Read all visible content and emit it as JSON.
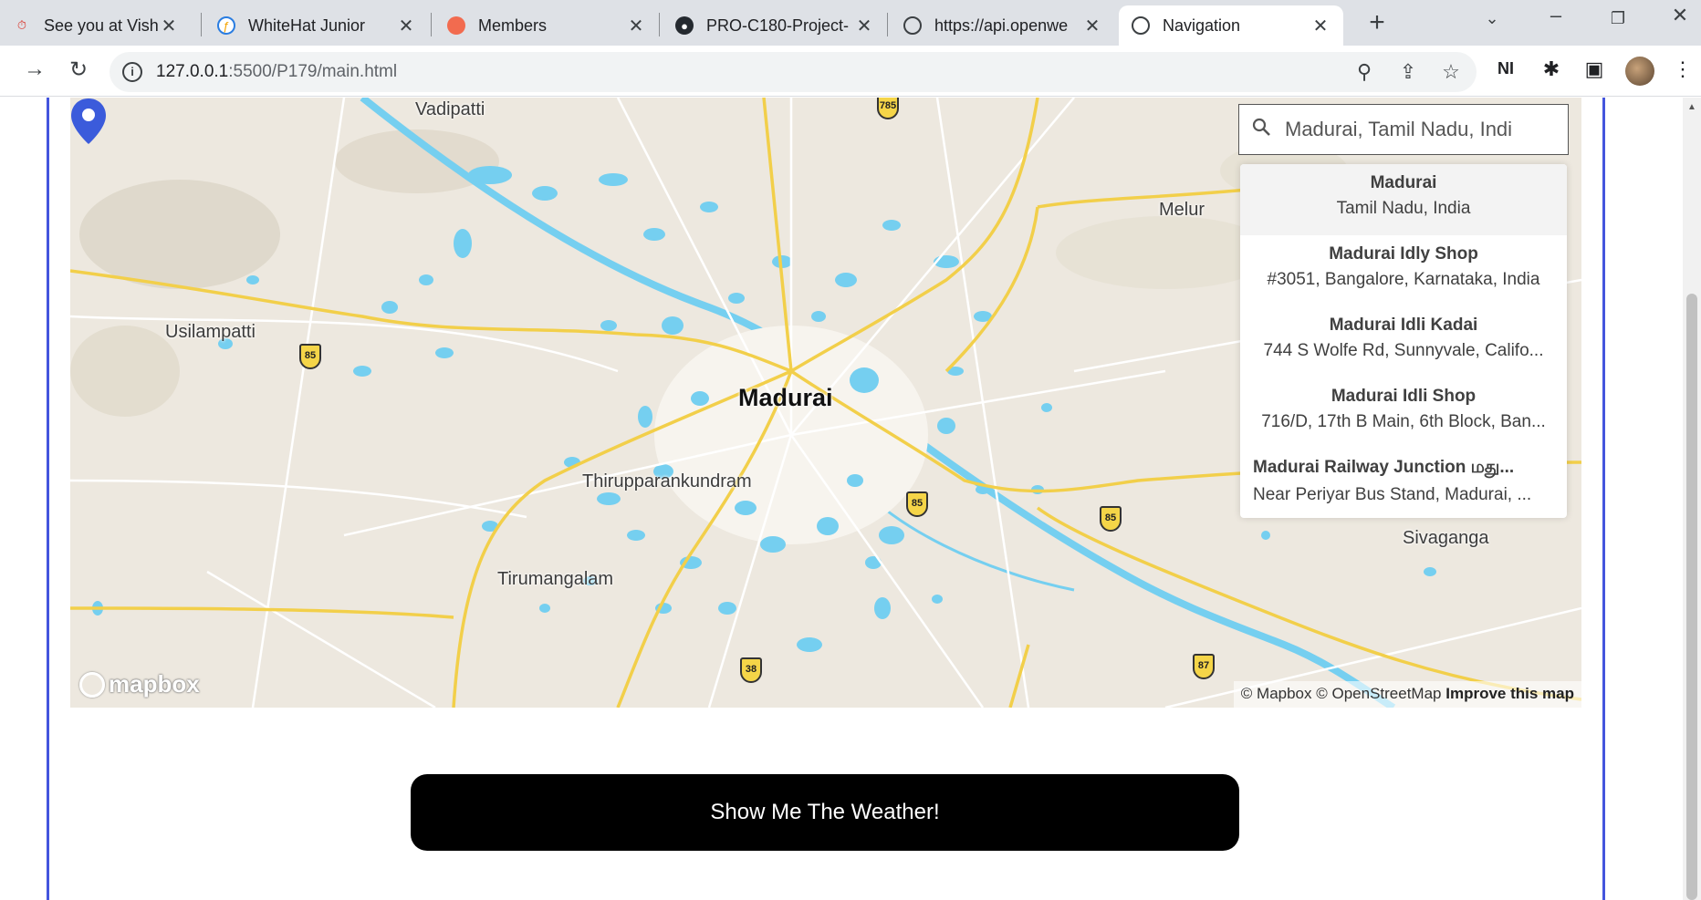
{
  "browser": {
    "tabs": [
      {
        "title": "See you at Vishn",
        "favicon": "stopwatch-icon"
      },
      {
        "title": "WhiteHat Junior",
        "favicon": "whitehat-icon"
      },
      {
        "title": "Members",
        "favicon": "members-icon"
      },
      {
        "title": "PRO-C180-Project-",
        "favicon": "github-icon"
      },
      {
        "title": "https://api.openwe",
        "favicon": "globe-icon"
      },
      {
        "title": "Navigation",
        "favicon": "globe-icon",
        "active": true
      }
    ],
    "url_host": "127.0.0.1",
    "url_path": ":5500/P179/main.html"
  },
  "map": {
    "places": {
      "vadipatti": "Vadipatti",
      "melur": "Melur",
      "usilampatti": "Usilampatti",
      "madurai": "Madurai",
      "thirupparankundram": "Thirupparankundram",
      "tirumangalam": "Tirumangalam",
      "sivaganga": "Sivaganga"
    },
    "shields": {
      "s785": "785",
      "s85a": "85",
      "s85b": "85",
      "s85c": "85",
      "s38": "38",
      "s87": "87"
    },
    "logo": "mapbox",
    "attribution": "© Mapbox © OpenStreetMap",
    "improve_link": "Improve this map",
    "colors": {
      "land": "#ede8df",
      "water": "#75cff0",
      "road": "#f2cf4a",
      "pin": "#3b5bdb"
    }
  },
  "geocoder": {
    "value": "Madurai, Tamil Nadu, Indi",
    "suggestions": [
      {
        "name": "Madurai",
        "address": "Tamil Nadu, India"
      },
      {
        "name": "Madurai Idly Shop",
        "address": "#3051, Bangalore, Karnataka, India"
      },
      {
        "name": "Madurai Idli Kadai",
        "address": "744 S Wolfe Rd, Sunnyvale, Califo..."
      },
      {
        "name": "Madurai Idli Shop",
        "address": "716/D, 17th B Main, 6th Block, Ban..."
      },
      {
        "name": "Madurai Railway Junction மது...",
        "address": "Near Periyar Bus Stand, Madurai, ..."
      }
    ]
  },
  "button": {
    "label": "Show Me The Weather!"
  }
}
